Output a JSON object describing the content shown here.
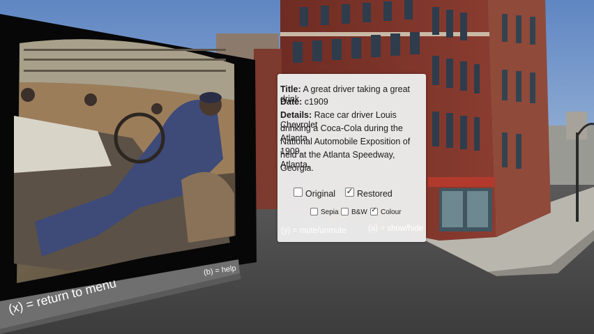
{
  "info": {
    "title_label": "Title:",
    "title": "A great driver taking a great drink",
    "date_label": "Date:",
    "date": "c1909",
    "details_label": "Details:",
    "details_lines": [
      "Race car driver Louis Chevrolet",
      "drinking a Coca-Cola during the Atlanta",
      "National Automobile Exposition of 1909,",
      "held at the Atlanta Speedway, Atlanta,",
      "Georgia."
    ],
    "options": {
      "original": {
        "label": "Original",
        "checked": false
      },
      "restored": {
        "label": "Restored",
        "checked": true
      }
    },
    "filters": {
      "sepia": {
        "label": "Sepia",
        "checked": false
      },
      "bw": {
        "label": "B&W",
        "checked": false
      },
      "colour": {
        "label": "Colour",
        "checked": true
      }
    },
    "hint_mute": "(y) = mute/unmute",
    "hint_showhide": "(a) = show/hide"
  },
  "screen": {
    "hint_help": "(b) = help",
    "hint_return": "(x) = return to menu"
  },
  "colors": {
    "sky": "#6f92c8",
    "brick": "#7a3328",
    "panel": "#ececec",
    "frame": "#0a0a0a"
  }
}
